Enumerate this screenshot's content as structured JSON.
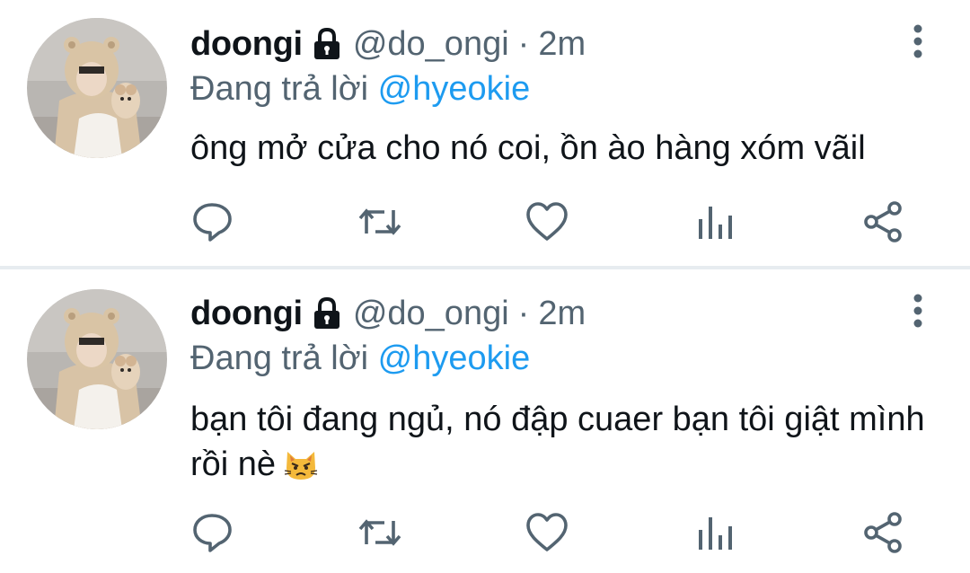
{
  "colors": {
    "primary_text": "#0f1419",
    "secondary_text": "#536471",
    "mention_blue": "#1d9bf0",
    "divider": "#e7ecf0",
    "icon_gray": "#536471"
  },
  "tweets": [
    {
      "display_name": "doongi",
      "locked_icon": "lock-icon",
      "handle": "@do_ongi",
      "separator": "·",
      "time": "2m",
      "reply_prefix": "Đang trả lời",
      "reply_mention": "@hyeokie",
      "text": "ông mở cửa cho nó coi, ồn ào hàng xóm vãil",
      "emoji": "",
      "actions": [
        "reply-icon",
        "retweet-icon",
        "like-icon",
        "stats-icon",
        "share-icon"
      ]
    },
    {
      "display_name": "doongi",
      "locked_icon": "lock-icon",
      "handle": "@do_ongi",
      "separator": "·",
      "time": "2m",
      "reply_prefix": "Đang trả lời",
      "reply_mention": "@hyeokie",
      "text": "bạn tôi đang ngủ, nó đập cuaer bạn tôi giật mình rồi nè",
      "emoji": "pouting-cat-emoji",
      "actions": [
        "reply-icon",
        "retweet-icon",
        "like-icon",
        "stats-icon",
        "share-icon"
      ]
    }
  ]
}
